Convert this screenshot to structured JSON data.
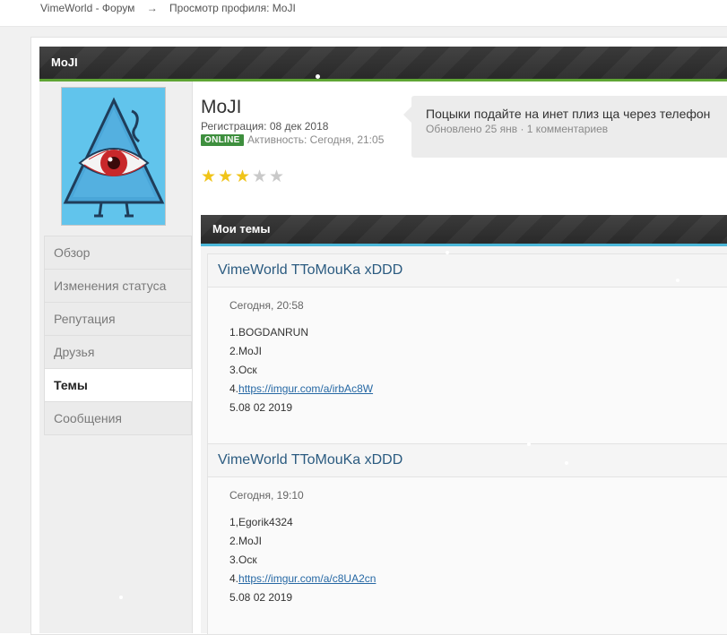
{
  "breadcrumb": {
    "items": [
      "VimeWorld - Форум",
      "Просмотр профиля: MoJI"
    ],
    "separator": "→"
  },
  "profile": {
    "header_title": "MoJI",
    "username": "MoJI",
    "registration": "Регистрация: 08 дек 2018",
    "online_badge": "ONLINE",
    "activity": "Активность: Сегодня, 21:05",
    "rating": {
      "filled": 3,
      "total": 5
    },
    "status": {
      "text": "Поцыки подайте на инет плиз ща через телефон",
      "updated": "Обновлено 25 янв",
      "bullet": "·",
      "comments": "1 комментариев"
    }
  },
  "nav": {
    "items": [
      "Обзор",
      "Изменения статуса",
      "Репутация",
      "Друзья",
      "Темы",
      "Сообщения"
    ],
    "active_index": 4
  },
  "topics": {
    "header": "Мои темы",
    "list": [
      {
        "title": "VimeWorld TToMouKa xDDD",
        "date": "Сегодня, 20:58",
        "lines": [
          "1.BOGDANRUN",
          "2.MoJI",
          "3.Оск"
        ],
        "link_prefix": "4.",
        "link": "https://imgur.com/a/irbAc8W",
        "last_line": "5.08 02 2019"
      },
      {
        "title": "VimeWorld TToMouKa xDDD",
        "date": "Сегодня, 19:10",
        "lines": [
          "1,Egorik4324",
          "2.MoJI",
          "3.Оск"
        ],
        "link_prefix": "4.",
        "link": "https://imgur.com/a/c8UA2cn",
        "last_line": "5.08 02 2019"
      }
    ]
  },
  "colors": {
    "profile_accent": "#5fa534",
    "topics_accent": "#4bb8d9",
    "online": "#3e8f3e",
    "link": "#2668a4",
    "topic_title": "#2b5b80",
    "avatar_bg": "#61c4ec"
  },
  "icons": [
    "eye-pyramid-avatar",
    "star-icon"
  ]
}
